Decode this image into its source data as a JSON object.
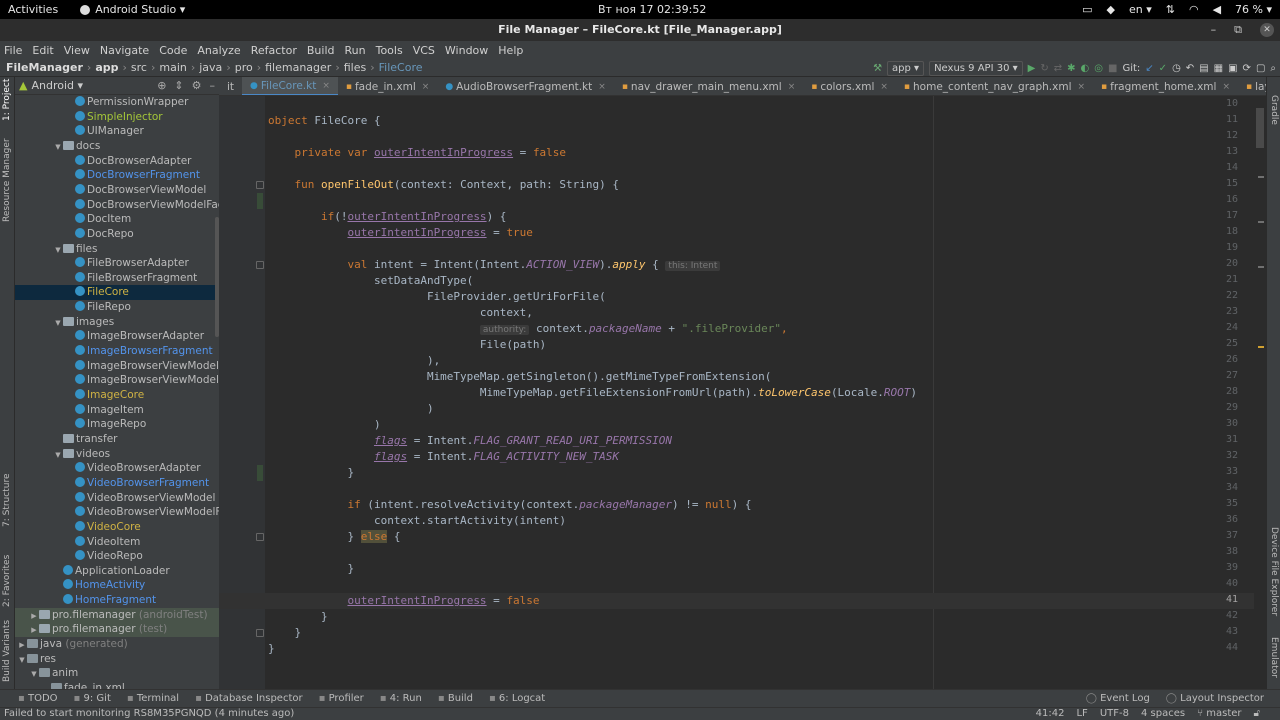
{
  "gnome": {
    "activities": "Activities",
    "app": "Android Studio ▾",
    "clock": "Вт ноя 17  02:39:52",
    "lang": "en ▾",
    "battery": "76 % ▾"
  },
  "window": {
    "title": "File Manager – FileCore.kt [File_Manager.app]"
  },
  "menu": [
    "File",
    "Edit",
    "View",
    "Navigate",
    "Code",
    "Analyze",
    "Refactor",
    "Build",
    "Run",
    "Tools",
    "VCS",
    "Window",
    "Help"
  ],
  "breadcrumbs": [
    "FileManager",
    "app",
    "src",
    "main",
    "java",
    "pro",
    "filemanager",
    "files",
    "FileCore"
  ],
  "toolbar": {
    "config": "app ▾",
    "device": "Nexus 9 API 30 ▾",
    "git": "Git:"
  },
  "project": {
    "view": "Android ▾"
  },
  "tree": [
    {
      "label": "PermissionWrapper",
      "indent": 5,
      "type": "kt",
      "color": "default"
    },
    {
      "label": "SimpleInjector",
      "indent": 5,
      "type": "kt",
      "color": "green"
    },
    {
      "label": "UIManager",
      "indent": 5,
      "type": "kt",
      "color": "default"
    },
    {
      "label": "docs",
      "indent": 4,
      "type": "pkg",
      "arrow": "▼",
      "color": "default"
    },
    {
      "label": "DocBrowserAdapter",
      "indent": 5,
      "type": "kt",
      "color": "default"
    },
    {
      "label": "DocBrowserFragment",
      "indent": 5,
      "type": "kt",
      "color": "blue"
    },
    {
      "label": "DocBrowserViewModel",
      "indent": 5,
      "type": "kt",
      "color": "default"
    },
    {
      "label": "DocBrowserViewModelFacto",
      "indent": 5,
      "type": "kt",
      "color": "default"
    },
    {
      "label": "DocItem",
      "indent": 5,
      "type": "kt",
      "color": "default"
    },
    {
      "label": "DocRepo",
      "indent": 5,
      "type": "kt",
      "color": "default"
    },
    {
      "label": "files",
      "indent": 4,
      "type": "pkg",
      "arrow": "▼",
      "color": "default"
    },
    {
      "label": "FileBrowserAdapter",
      "indent": 5,
      "type": "kt",
      "color": "default"
    },
    {
      "label": "FileBrowserFragment",
      "indent": 5,
      "type": "kt",
      "color": "default"
    },
    {
      "label": "FileCore",
      "indent": 5,
      "type": "kt",
      "color": "yellow",
      "selected": true
    },
    {
      "label": "FileRepo",
      "indent": 5,
      "type": "kt",
      "color": "default"
    },
    {
      "label": "images",
      "indent": 4,
      "type": "pkg",
      "arrow": "▼",
      "color": "default"
    },
    {
      "label": "ImageBrowserAdapter",
      "indent": 5,
      "type": "kt",
      "color": "default"
    },
    {
      "label": "ImageBrowserFragment",
      "indent": 5,
      "type": "kt",
      "color": "blue"
    },
    {
      "label": "ImageBrowserViewModel",
      "indent": 5,
      "type": "kt",
      "color": "default"
    },
    {
      "label": "ImageBrowserViewModelFa",
      "indent": 5,
      "type": "kt",
      "color": "default"
    },
    {
      "label": "ImageCore",
      "indent": 5,
      "type": "kt",
      "color": "yellow"
    },
    {
      "label": "ImageItem",
      "indent": 5,
      "type": "kt",
      "color": "default"
    },
    {
      "label": "ImageRepo",
      "indent": 5,
      "type": "kt",
      "color": "default"
    },
    {
      "label": "transfer",
      "indent": 4,
      "type": "pkg",
      "arrow": "",
      "color": "default"
    },
    {
      "label": "videos",
      "indent": 4,
      "type": "pkg",
      "arrow": "▼",
      "color": "default"
    },
    {
      "label": "VideoBrowserAdapter",
      "indent": 5,
      "type": "kt",
      "color": "default"
    },
    {
      "label": "VideoBrowserFragment",
      "indent": 5,
      "type": "kt",
      "color": "blue"
    },
    {
      "label": "VideoBrowserViewModel",
      "indent": 5,
      "type": "kt",
      "color": "default"
    },
    {
      "label": "VideoBrowserViewModelFac",
      "indent": 5,
      "type": "kt",
      "color": "default"
    },
    {
      "label": "VideoCore",
      "indent": 5,
      "type": "kt",
      "color": "yellow"
    },
    {
      "label": "VideoItem",
      "indent": 5,
      "type": "kt",
      "color": "default"
    },
    {
      "label": "VideoRepo",
      "indent": 5,
      "type": "kt",
      "color": "default"
    },
    {
      "label": "ApplicationLoader",
      "indent": 4,
      "type": "kt",
      "color": "default"
    },
    {
      "label": "HomeActivity",
      "indent": 4,
      "type": "kt",
      "color": "blue"
    },
    {
      "label": "HomeFragment",
      "indent": 4,
      "type": "kt",
      "color": "blue"
    },
    {
      "label": "pro.filemanager",
      "suffix": "(androidTest)",
      "indent": 2,
      "type": "pkg",
      "arrow": "▶",
      "color": "default",
      "hl": true
    },
    {
      "label": "pro.filemanager",
      "suffix": "(test)",
      "indent": 2,
      "type": "pkg",
      "arrow": "▶",
      "color": "default",
      "hl": true
    },
    {
      "label": "java",
      "suffix": "(generated)",
      "indent": 1,
      "type": "folder",
      "arrow": "▶",
      "color": "default"
    },
    {
      "label": "res",
      "indent": 1,
      "type": "folder",
      "arrow": "▼",
      "color": "default"
    },
    {
      "label": "anim",
      "indent": 2,
      "type": "folder",
      "arrow": "▼",
      "color": "default"
    },
    {
      "label": "fade_in.xml",
      "indent": 3,
      "type": "xml",
      "color": "default"
    }
  ],
  "tabs": [
    {
      "label": "it",
      "type": "none"
    },
    {
      "label": "FileCore.kt",
      "type": "kt",
      "active": true
    },
    {
      "label": "fade_in.xml",
      "type": "xml"
    },
    {
      "label": "AudioBrowserFragment.kt",
      "type": "kt"
    },
    {
      "label": "nav_drawer_main_menu.xml",
      "type": "xml"
    },
    {
      "label": "colors.xml",
      "type": "xml"
    },
    {
      "label": "home_content_nav_graph.xml",
      "type": "xml"
    },
    {
      "label": "fragment_home.xml",
      "type": "xml"
    },
    {
      "label": "layout_base_toolbar.xml",
      "type": "xml"
    }
  ],
  "editor": {
    "line_numbers": [
      "10",
      "11",
      "12",
      "13",
      "14",
      "15",
      "16",
      "17",
      "18",
      "19",
      "20",
      "21",
      "22",
      "23",
      "24",
      "25",
      "26",
      "27",
      "28",
      "29",
      "30",
      "31",
      "32",
      "33",
      "34",
      "35",
      "36",
      "37",
      "38",
      "39",
      "40",
      "41",
      "42",
      "43",
      "44"
    ],
    "current_line": "41",
    "hint_this": "this: Intent",
    "hint_authority": "authority:"
  },
  "left_stripe": [
    "1: Project",
    "Resource Manager",
    "7: Structure",
    "2: Favorites",
    "Build Variants"
  ],
  "right_stripe": [
    "Gradle",
    "Device File Explorer",
    "Emulator"
  ],
  "bottom_tools": [
    "TODO",
    "9: Git",
    "Terminal",
    "Database Inspector",
    "Profiler",
    "4: Run",
    "Build",
    "6: Logcat"
  ],
  "bottom_tools_right": [
    "Event Log",
    "Layout Inspector"
  ],
  "status": {
    "message": "Failed to start monitoring RS8M35PGNQD (4 minutes ago)",
    "position": "41:42",
    "line_sep": "LF",
    "encoding": "UTF-8",
    "indent": "4 spaces",
    "branch": "master"
  }
}
